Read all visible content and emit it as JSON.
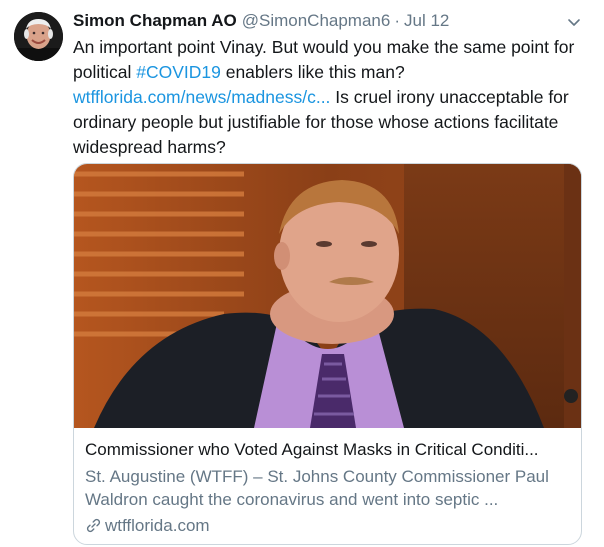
{
  "tweet": {
    "display_name": "Simon Chapman AO",
    "handle": "@SimonChapman6",
    "separator": "·",
    "timestamp": "Jul 12",
    "text_part1": "An important point Vinay. But would you make the same point for political ",
    "hashtag": "#COVID19",
    "text_part2": " enablers like this man? ",
    "link_text": "wtfflorida.com/news/madness/c...",
    "text_part3": " Is cruel irony unacceptable for ordinary people but justifiable for those whose actions facilitate widespread harms?"
  },
  "card": {
    "title": "Commissioner who Voted Against Masks in Critical Conditi...",
    "description": "St. Augustine (WTFF) – St. Johns County Commissioner Paul Waldron caught the coronavirus and went into septic ...",
    "domain": "wtfflorida.com"
  },
  "icons": {
    "caret": "chevron-down-icon",
    "link": "link-icon"
  },
  "colors": {
    "link": "#1b95e0",
    "secondary_text": "#657786",
    "border": "#ccd6dd"
  }
}
